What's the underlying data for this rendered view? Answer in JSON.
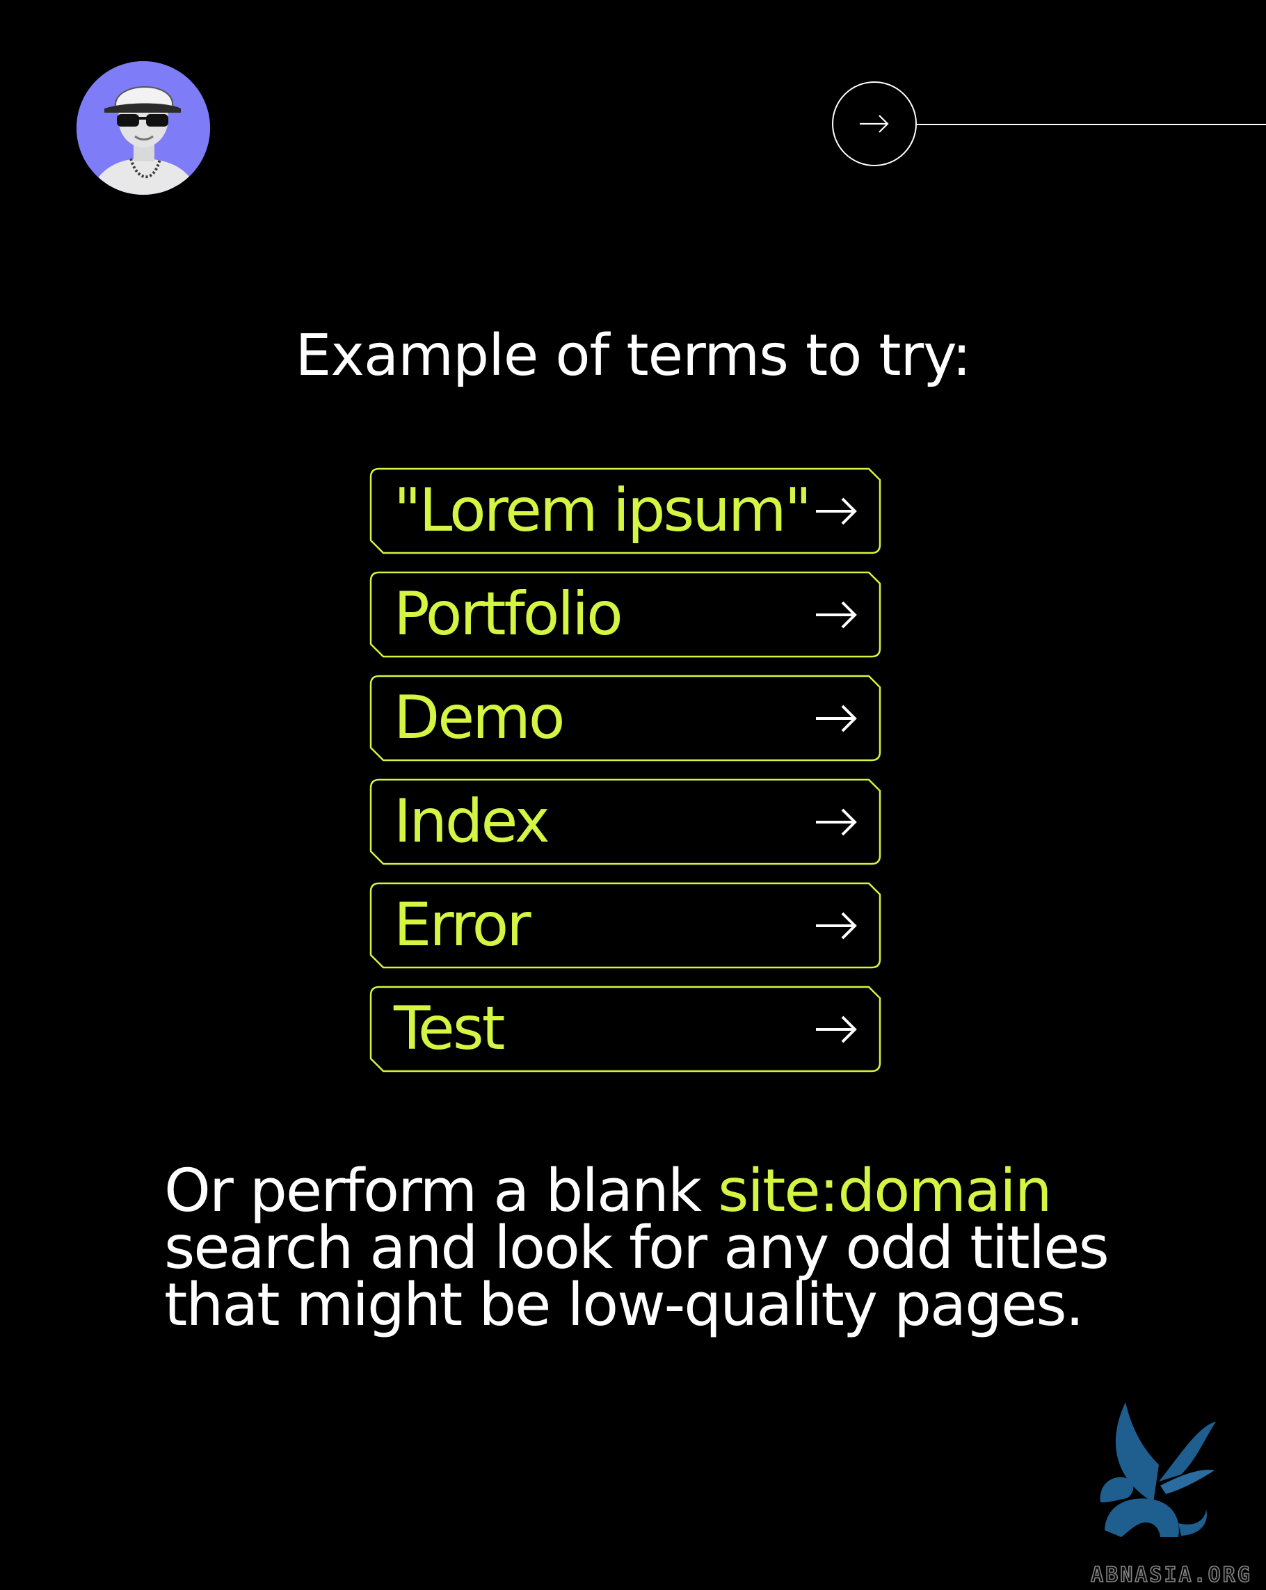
{
  "avatar": {
    "icon": "person-with-cap-and-sunglasses",
    "background": "#7f7cf7"
  },
  "nav": {
    "next_icon": "arrow-right-icon"
  },
  "heading": "Example of terms to try:",
  "terms": [
    {
      "label": "\"Lorem ipsum\"",
      "icon": "arrow-right-icon"
    },
    {
      "label": "Portfolio",
      "icon": "arrow-right-icon"
    },
    {
      "label": "Demo",
      "icon": "arrow-right-icon"
    },
    {
      "label": "Index",
      "icon": "arrow-right-icon"
    },
    {
      "label": "Error",
      "icon": "arrow-right-icon"
    },
    {
      "label": "Test",
      "icon": "arrow-right-icon"
    }
  ],
  "footer": {
    "prefix": "Or perform a blank ",
    "highlight": "site:domain",
    "suffix": " search and look for any odd titles that might be low-quality pages."
  },
  "watermark": {
    "text": "ABNASIA.ORG",
    "icon": "griffin-logo"
  },
  "colors": {
    "background": "#000000",
    "accent": "#d4f542",
    "text": "#ffffff",
    "watermark_blue": "#1f5f8f"
  }
}
